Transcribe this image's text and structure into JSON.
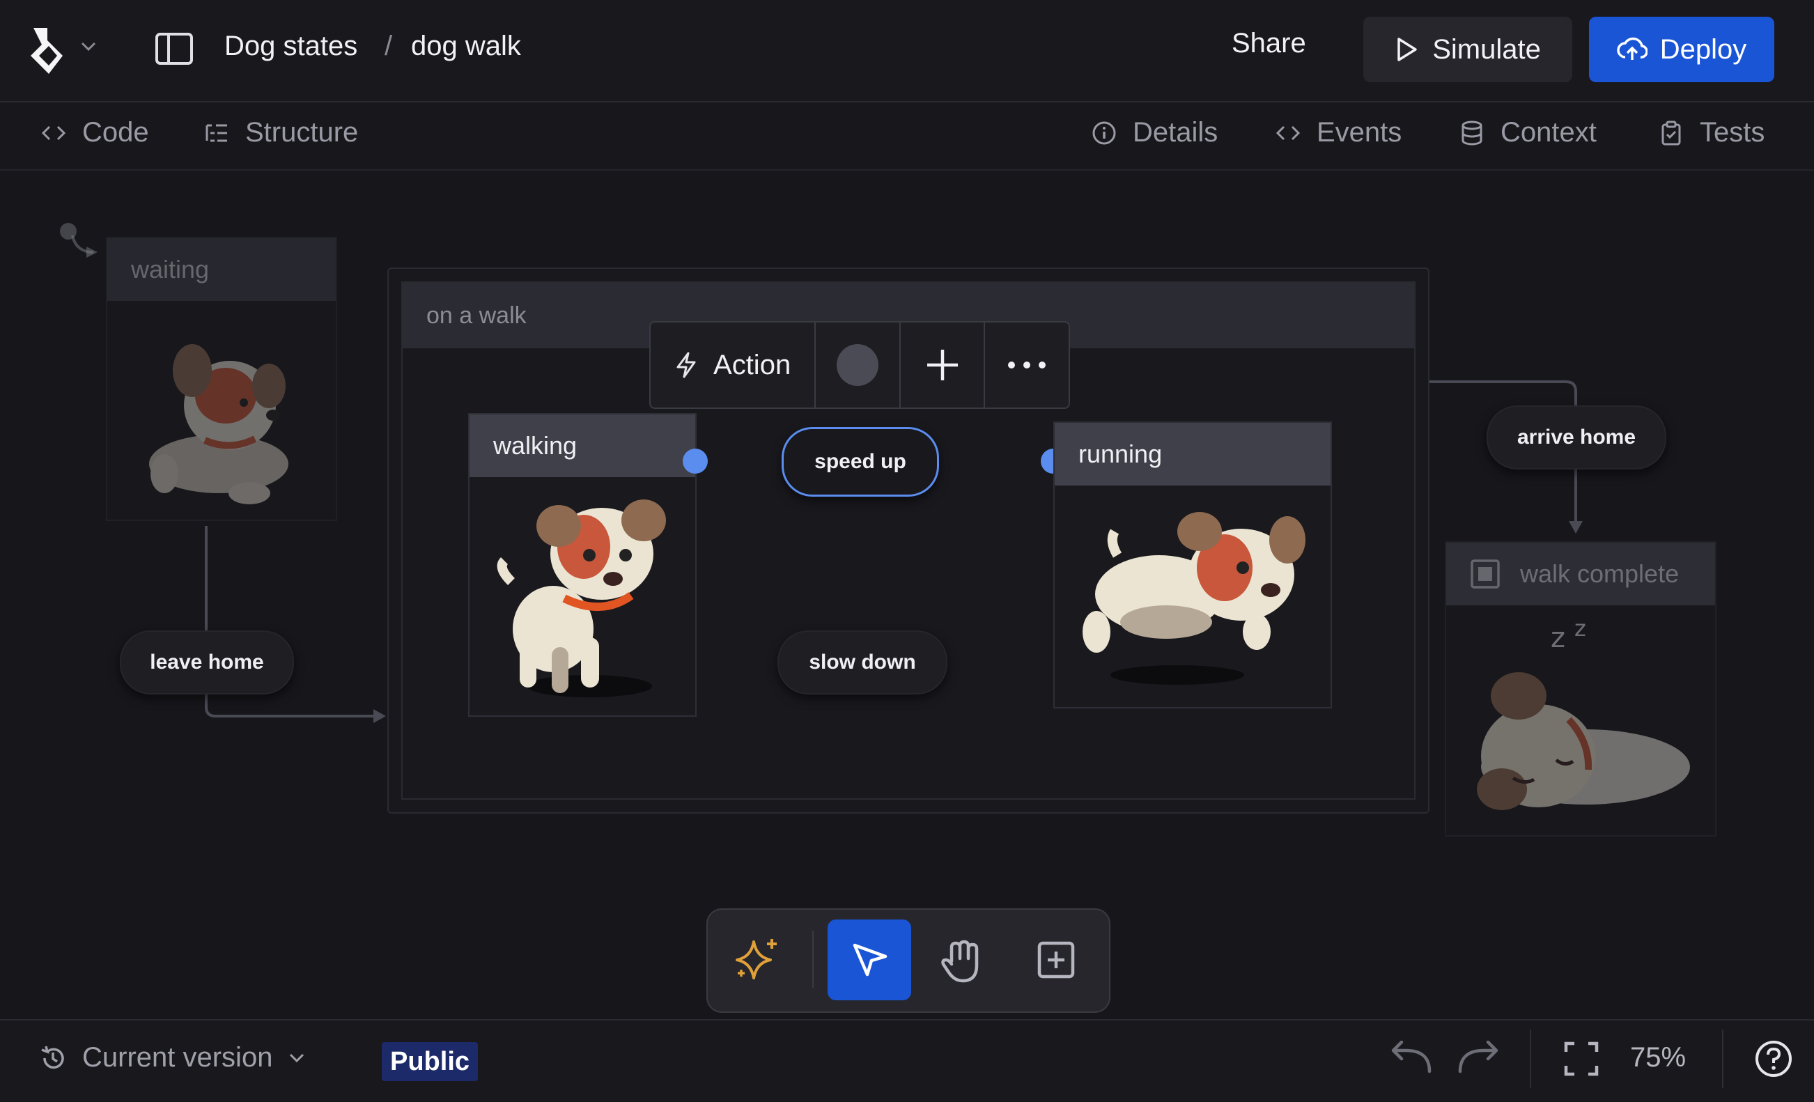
{
  "header": {
    "breadcrumb_project": "Dog states",
    "breadcrumb_separator": "/",
    "breadcrumb_machine": "dog walk",
    "share_label": "Share",
    "simulate_label": "Simulate",
    "deploy_label": "Deploy"
  },
  "subnav": {
    "left_tabs": [
      {
        "label": "Code",
        "icon": "code-icon"
      },
      {
        "label": "Structure",
        "icon": "structure-icon"
      }
    ],
    "right_tabs": [
      {
        "label": "Details",
        "icon": "info-icon"
      },
      {
        "label": "Events",
        "icon": "code-icon"
      },
      {
        "label": "Context",
        "icon": "database-icon"
      },
      {
        "label": "Tests",
        "icon": "clipboard-check-icon"
      }
    ]
  },
  "canvas": {
    "states": {
      "waiting": "waiting",
      "on_a_walk": "on a walk",
      "walking": "walking",
      "running": "running",
      "walk_complete": "walk complete"
    },
    "transitions": {
      "leave_home": "leave home",
      "speed_up": "speed up",
      "slow_down": "slow down",
      "arrive_home": "arrive home"
    },
    "context_menu": {
      "action_label": "Action"
    }
  },
  "tools": [
    "sparkles-icon",
    "pointer-icon",
    "hand-icon",
    "add-box-icon"
  ],
  "footer": {
    "version_label": "Current version",
    "visibility_badge": "Public",
    "zoom": "75%"
  },
  "colors": {
    "accent": "#1a55d6",
    "handle": "#5b8def",
    "sparkle": "#e0a13a"
  }
}
